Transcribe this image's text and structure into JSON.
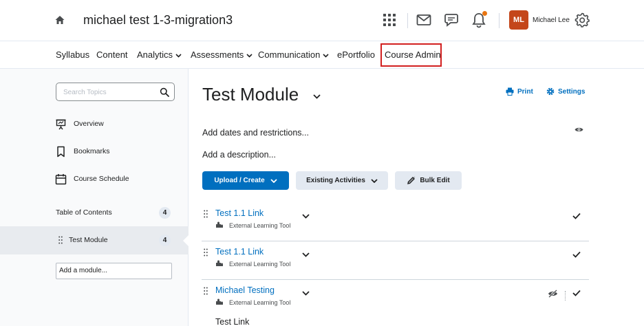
{
  "header": {
    "course_title": "michael test 1-3-migration3",
    "user_initials": "ML",
    "user_name": "Michael Lee",
    "avatar_color": "#c4461a",
    "notification_color": "#e87511"
  },
  "nav": {
    "items": [
      {
        "label": "Syllabus"
      },
      {
        "label": "Content"
      },
      {
        "label": "Analytics",
        "dropdown": true
      },
      {
        "label": "Assessments",
        "dropdown": true
      },
      {
        "label": "Communication",
        "dropdown": true
      },
      {
        "label": "ePortfolio"
      },
      {
        "label": "Course Admin",
        "highlighted": true
      }
    ]
  },
  "sidebar": {
    "search_placeholder": "Search Topics",
    "links": [
      {
        "label": "Overview",
        "icon": "presentation-icon"
      },
      {
        "label": "Bookmarks",
        "icon": "bookmark-icon"
      },
      {
        "label": "Course Schedule",
        "icon": "calendar-icon"
      }
    ],
    "toc_label": "Table of Contents",
    "toc_count": "4",
    "module_label": "Test Module",
    "module_count": "4",
    "add_module_placeholder": "Add a module..."
  },
  "main": {
    "module_title": "Test Module",
    "print_label": "Print",
    "settings_label": "Settings",
    "dates_label": "Add dates and restrictions...",
    "description_label": "Add a description...",
    "buttons": {
      "upload": "Upload / Create",
      "existing": "Existing Activities",
      "bulk_edit": "Bulk Edit"
    },
    "accent_color": "#006fbf",
    "activities": [
      {
        "title": "Test 1.1 Link",
        "type": "External Learning Tool",
        "hidden": false
      },
      {
        "title": "Test 1.1 Link",
        "type": "External Learning Tool",
        "hidden": false
      },
      {
        "title": "Michael Testing",
        "type": "External Learning Tool",
        "hidden": true
      }
    ],
    "trailing_text": "Test Link"
  }
}
